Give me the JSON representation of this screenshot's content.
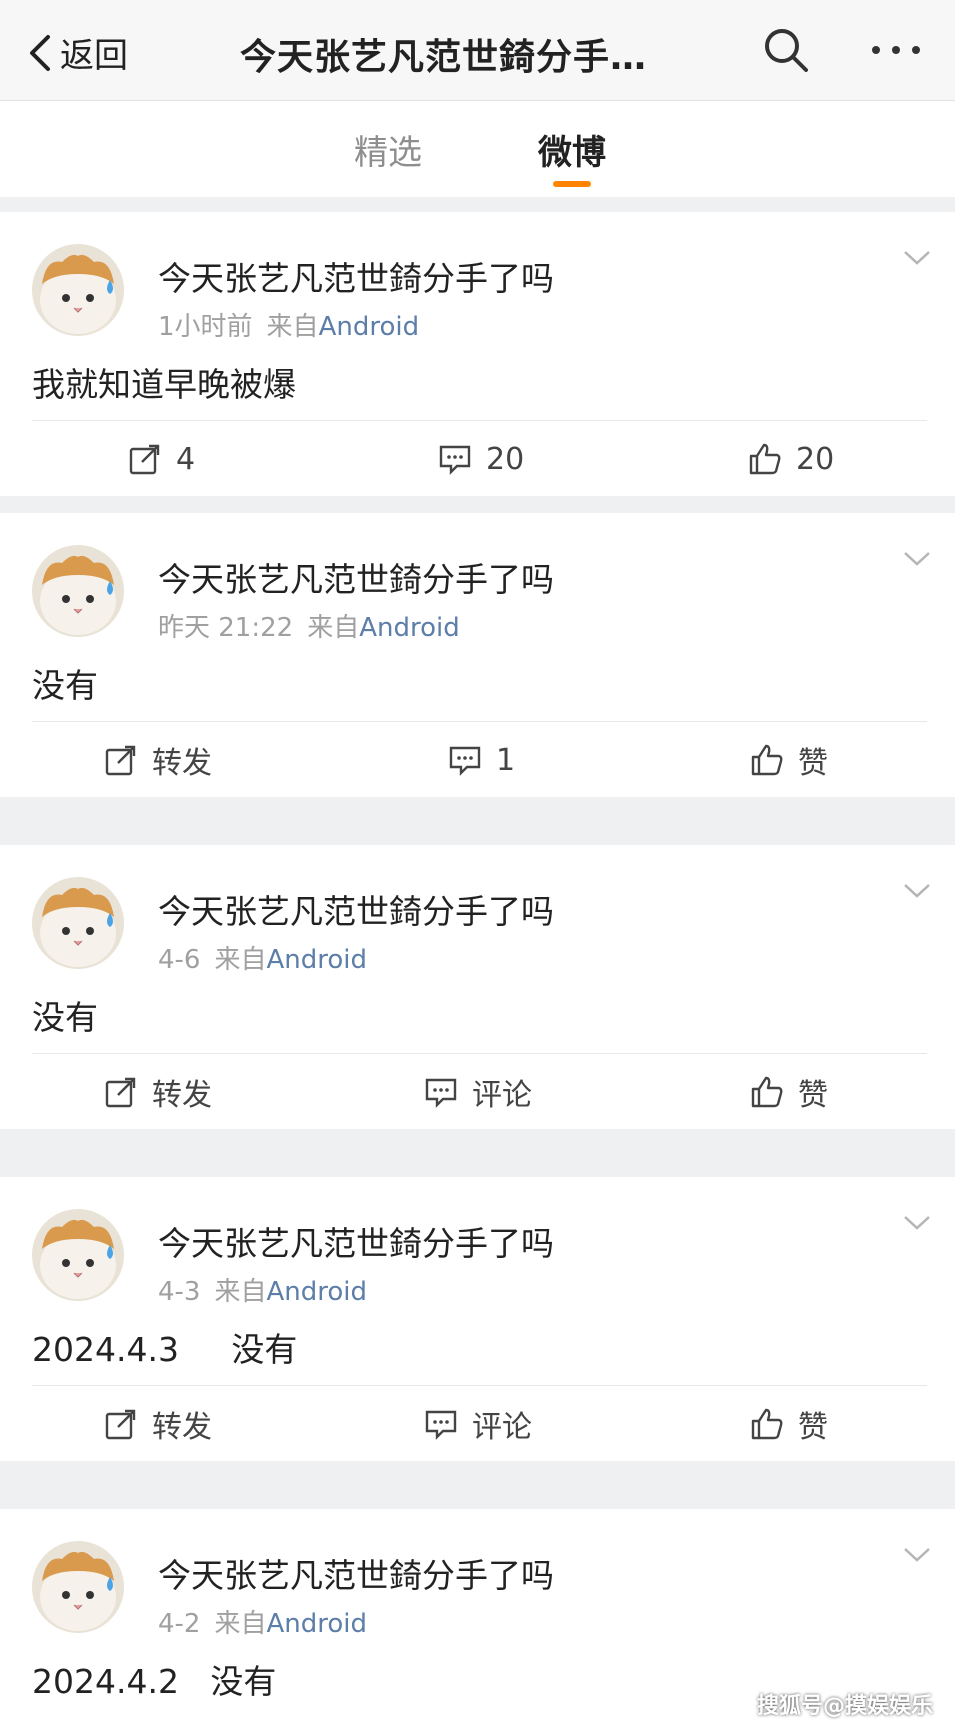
{
  "header": {
    "back_label": "返回",
    "title": "今天张艺凡范世錡分手…"
  },
  "tabs": [
    {
      "label": "精选",
      "active": false
    },
    {
      "label": "微博",
      "active": true
    }
  ],
  "colors": {
    "tab_accent": "#ff8200",
    "source_link": "#5c7ea8",
    "meta_text": "#a0a0a0"
  },
  "posts": [
    {
      "username": "今天张艺凡范世錡分手了吗",
      "time": "1小时前",
      "source_prefix": "来自",
      "source": "Android",
      "content": "我就知道早晚被爆",
      "repost": "4",
      "comment": "20",
      "like": "20"
    },
    {
      "username": "今天张艺凡范世錡分手了吗",
      "time": "昨天 21:22",
      "source_prefix": "来自",
      "source": "Android",
      "content": "没有",
      "repost": "转发",
      "comment": "1",
      "like": "赞"
    },
    {
      "username": "今天张艺凡范世錡分手了吗",
      "time": "4-6",
      "source_prefix": "来自",
      "source": "Android",
      "content": "没有",
      "repost": "转发",
      "comment": "评论",
      "like": "赞"
    },
    {
      "username": "今天张艺凡范世錡分手了吗",
      "time": "4-3",
      "source_prefix": "来自",
      "source": "Android",
      "content": "2024.4.3     没有",
      "repost": "转发",
      "comment": "评论",
      "like": "赞"
    },
    {
      "username": "今天张艺凡范世錡分手了吗",
      "time": "4-2",
      "source_prefix": "来自",
      "source": "Android",
      "content": "2024.4.2   没有"
    }
  ],
  "watermark": "搜狐号@摸娱娱乐"
}
